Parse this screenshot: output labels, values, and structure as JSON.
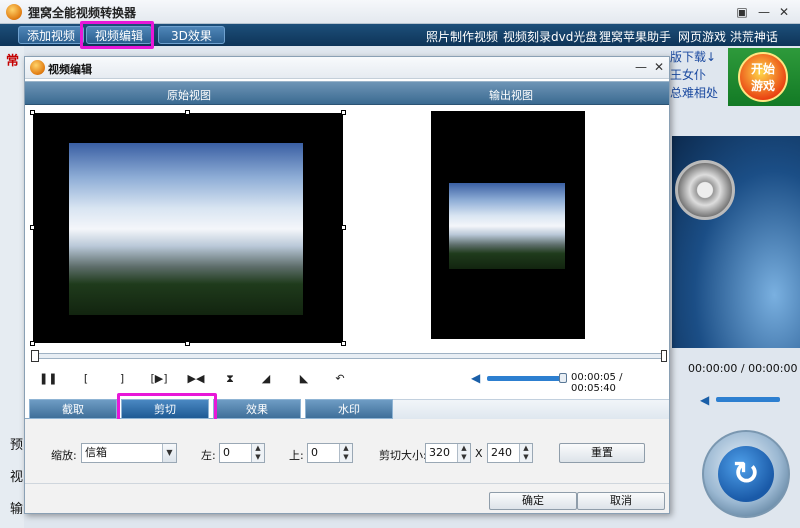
{
  "app": {
    "title": "狸窝全能视频转换器",
    "window_controls": {
      "pin": "▣",
      "minimize": "—",
      "close": "✕"
    }
  },
  "toolbar": {
    "add_video": "添加视频",
    "video_edit": "视频编辑",
    "effect_3d": "3D效果",
    "links": [
      "照片制作视频",
      "视频刻录dvd光盘",
      "狸窝苹果助手",
      "网页游戏 洪荒神话"
    ]
  },
  "background": {
    "left_fragment": "常",
    "ad_lines": [
      "版下载↓",
      "王女仆",
      "总难相处"
    ],
    "game_banner": "开始\n游戏",
    "main_time": "00:00:00 / 00:00:00",
    "left_labels": [
      "预",
      "视",
      "输"
    ],
    "convert_button_icon": "convert-icon"
  },
  "dialog": {
    "title": "视频编辑",
    "minimize": "—",
    "close": "✕",
    "original_view": "原始视图",
    "output_view": "输出视图",
    "playback": {
      "icons": [
        "pause-icon",
        "mark-in-icon",
        "mark-out-icon",
        "play-segment-icon",
        "prev-frame-icon",
        "split-icon",
        "rotate-left-icon",
        "rotate-right-icon",
        "undo-icon"
      ],
      "glyphs": [
        "❚❚",
        "[",
        "]",
        "[▶]",
        "▶◀",
        "⧗",
        "◢",
        "◣",
        "↶"
      ],
      "time": "00:00:05 / 00:05:40",
      "volume_fraction": 0.95,
      "timeline_fraction": 0.0
    },
    "tabs": [
      "截取",
      "剪切",
      "效果",
      "水印"
    ],
    "active_tab": "剪切",
    "crop": {
      "zoom_label": "缩放:",
      "zoom_value": "信箱",
      "left_label": "左:",
      "left_value": "0",
      "top_label": "上:",
      "top_value": "0",
      "size_label": "剪切大小:",
      "width": "320",
      "x_sep": "X",
      "height": "240",
      "reset": "重置"
    },
    "ok": "确定",
    "cancel": "取消"
  },
  "colors": {
    "highlight": "#e817d8",
    "accent": "#1e5a94",
    "toolbar": "#0e3458"
  }
}
